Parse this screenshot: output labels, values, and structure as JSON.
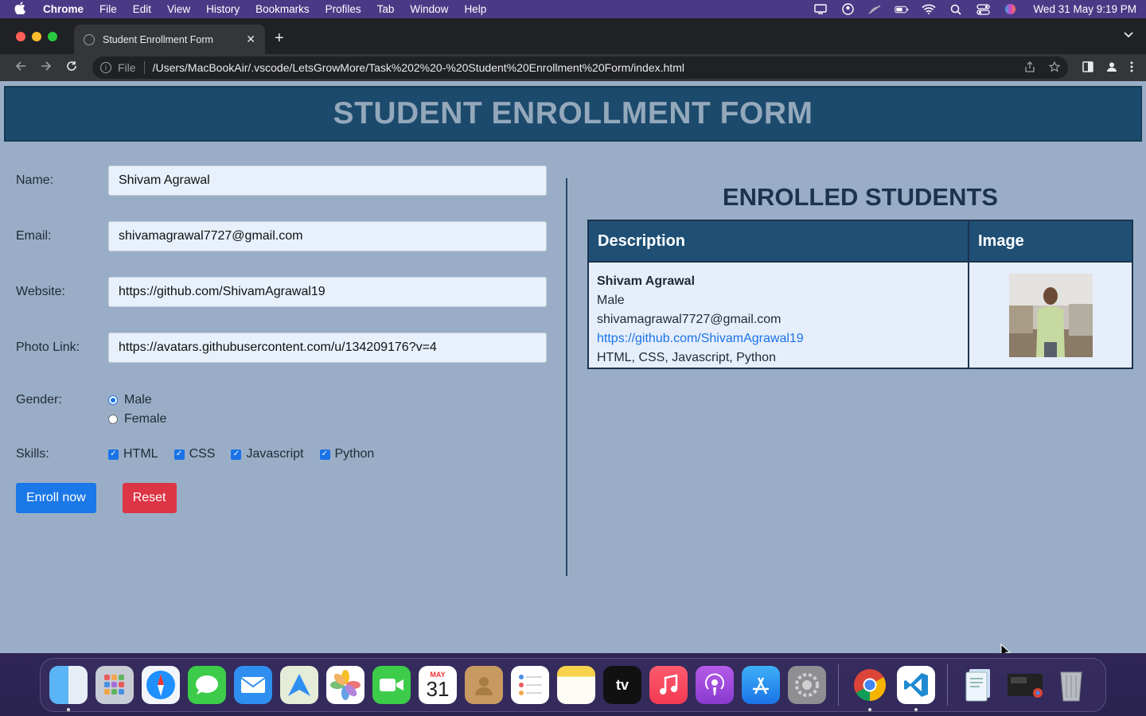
{
  "menubar": {
    "app": "Chrome",
    "items": [
      "File",
      "Edit",
      "View",
      "History",
      "Bookmarks",
      "Profiles",
      "Tab",
      "Window",
      "Help"
    ],
    "clock": "Wed 31 May  9:19 PM",
    "status_icons": [
      "display-icon",
      "user-circle-icon",
      "mute-icon",
      "battery-icon",
      "wifi-icon",
      "search-icon",
      "control-center-icon",
      "siri-icon"
    ]
  },
  "browser": {
    "tab_title": "Student Enrollment Form",
    "scheme": "File",
    "url": "/Users/MacBookAir/.vscode/LetsGrowMore/Task%202%20-%20Student%20Enrollment%20Form/index.html"
  },
  "page": {
    "header_title": "STUDENT ENROLLMENT FORM",
    "form": {
      "name_label": "Name:",
      "name_value": "Shivam Agrawal",
      "email_label": "Email:",
      "email_value": "shivamagrawal7727@gmail.com",
      "website_label": "Website:",
      "website_value": "https://github.com/ShivamAgrawal19",
      "photo_label": "Photo Link:",
      "photo_value": "https://avatars.githubusercontent.com/u/134209176?v=4",
      "gender_label": "Gender:",
      "gender_options": [
        {
          "label": "Male",
          "checked": true
        },
        {
          "label": "Female",
          "checked": false
        }
      ],
      "skills_label": "Skills:",
      "skills": [
        {
          "label": "HTML",
          "checked": true
        },
        {
          "label": "CSS",
          "checked": true
        },
        {
          "label": "Javascript",
          "checked": true
        },
        {
          "label": "Python",
          "checked": true
        }
      ],
      "enroll_button": "Enroll now",
      "reset_button": "Reset"
    },
    "enrolled": {
      "title": "ENROLLED STUDENTS",
      "columns": [
        "Description",
        "Image"
      ],
      "rows": [
        {
          "name": "Shivam Agrawal",
          "gender": "Male",
          "email": "shivamagrawal7727@gmail.com",
          "website": "https://github.com/ShivamAgrawal19",
          "skills": "HTML, CSS, Javascript, Python"
        }
      ]
    }
  },
  "dock": {
    "apps": [
      "Finder",
      "Launchpad",
      "Safari",
      "Messages",
      "Mail",
      "Maps",
      "Photos",
      "FaceTime",
      "Calendar",
      "Contacts",
      "Reminders",
      "Notes",
      "TV",
      "Music",
      "Podcasts",
      "App Store",
      "System Preferences",
      "Chrome",
      "VS Code",
      "Downloads",
      "Screenshots",
      "Trash"
    ],
    "calendar_month": "MAY",
    "calendar_day": "31",
    "tv_label": "tv"
  },
  "colors": {
    "page_bg": "#99aec6",
    "header_bg": "#1c4a6c",
    "enroll_btn": "#1a78e8",
    "reset_btn": "#dc3545",
    "table_header": "#1f4f74"
  }
}
